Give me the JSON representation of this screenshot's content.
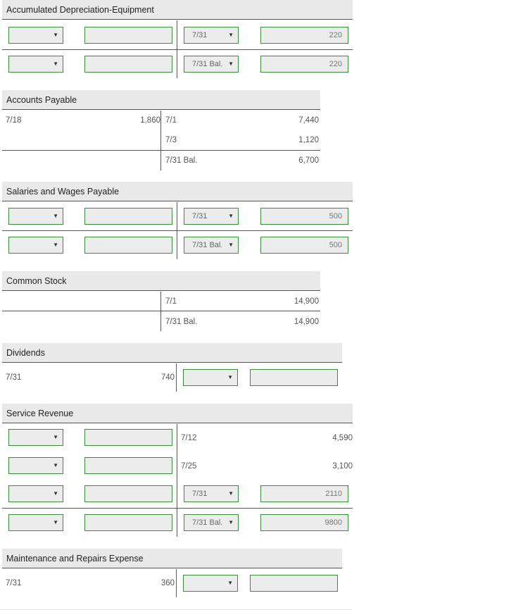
{
  "accounts": [
    {
      "title": "Accumulated Depreciation-Equipment",
      "rows": [
        {
          "right_date": "7/31",
          "right_amount": "220"
        },
        {
          "right_date": "7/31 Bal.",
          "right_amount": "220"
        }
      ]
    },
    {
      "title": "Accounts Payable",
      "left": {
        "date": "7/18",
        "amount": "1,860"
      },
      "right": [
        {
          "date": "7/1",
          "amount": "7,440"
        },
        {
          "date": "7/3",
          "amount": "1,120"
        },
        {
          "date": "7/31 Bal.",
          "amount": "6,700"
        }
      ]
    },
    {
      "title": "Salaries and Wages Payable",
      "rows": [
        {
          "right_date": "7/31",
          "right_amount": "500"
        },
        {
          "right_date": "7/31 Bal.",
          "right_amount": "500"
        }
      ]
    },
    {
      "title": "Common Stock",
      "right": [
        {
          "date": "7/1",
          "amount": "14,900"
        },
        {
          "date": "7/31 Bal.",
          "amount": "14,900"
        }
      ]
    },
    {
      "title": "Dividends",
      "left": {
        "date": "7/31",
        "amount": "740"
      }
    },
    {
      "title": "Service Revenue",
      "right_text": [
        {
          "date": "7/12",
          "amount": "4,590"
        },
        {
          "date": "7/25",
          "amount": "3,100"
        }
      ],
      "rows": [
        {
          "right_date": "7/31",
          "right_amount": "2110"
        },
        {
          "right_date": "7/31 Bal.",
          "right_amount": "9800"
        }
      ]
    },
    {
      "title": "Maintenance and Repairs Expense",
      "left": {
        "date": "7/31",
        "amount": "360"
      }
    }
  ]
}
